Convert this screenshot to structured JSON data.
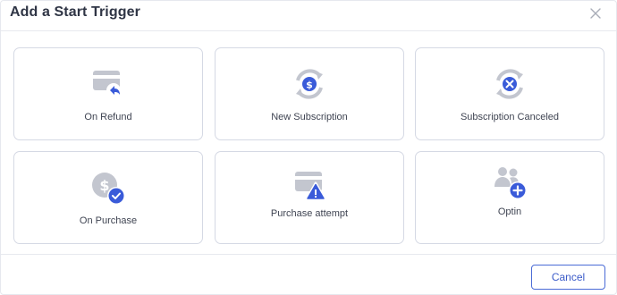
{
  "modal": {
    "title": "Add a Start Trigger",
    "close_icon": "close-icon"
  },
  "triggers": [
    {
      "label": "On Refund",
      "icon": "refund-card-icon"
    },
    {
      "label": "New Subscription",
      "icon": "subscription-dollar-icon"
    },
    {
      "label": "Subscription Canceled",
      "icon": "subscription-cancel-icon"
    },
    {
      "label": "On Purchase",
      "icon": "purchase-check-icon"
    },
    {
      "label": "Purchase attempt",
      "icon": "card-warning-icon"
    },
    {
      "label": "Optin",
      "icon": "users-add-icon"
    }
  ],
  "footer": {
    "cancel_label": "Cancel"
  },
  "colors": {
    "accent": "#3a5bd9",
    "icon_gray": "#c3c6cf",
    "card_border": "#d5d9e4"
  }
}
